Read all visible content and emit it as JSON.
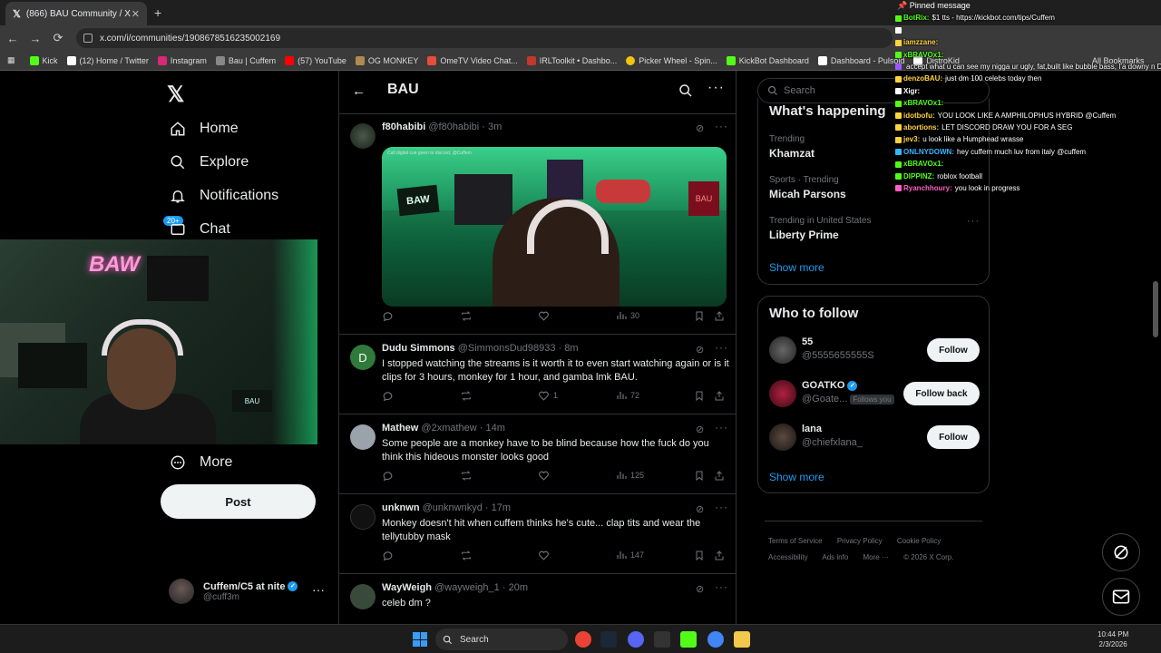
{
  "browser": {
    "tab_title": "(866) BAU Community / X",
    "url": "x.com/i/communities/1908678516235002169",
    "bookmarks": [
      "Kick",
      "(12) Home / Twitter",
      "Instagram",
      "Bau | Cuffem",
      "(57) YouTube",
      "OG MONKEY",
      "OmeTV Video Chat...",
      "IRLToolkit • Dashbo...",
      "Picker Wheel - Spin...",
      "KickBot Dashboard",
      "Dashboard - Pulsoid",
      "DistroKid"
    ],
    "all_bookmarks": "All Bookmarks"
  },
  "nav": {
    "items": [
      "Home",
      "Explore",
      "Notifications",
      "Chat",
      "More"
    ],
    "chat_badge": "20+",
    "post_label": "Post",
    "profile_name": "Cuffem/C5 at nite",
    "profile_handle": "@cuff3m"
  },
  "main": {
    "title": "BAU",
    "posts": [
      {
        "name": "f80habibi",
        "handle": "@f80habibi",
        "time": "· 3m",
        "text": "",
        "views": "30",
        "likes": "",
        "replies": "",
        "has_image": true,
        "image_caption": "Call digital cue given to discord, @Cuffem",
        "image_labels": {
          "left": "BAW",
          "right": "BAU"
        }
      },
      {
        "name": "Dudu Simmons",
        "handle": "@SimmonsDud98933",
        "time": "· 8m",
        "text": "I stopped watching the streams is it worth it to even start watching again or is it clips for 3 hours, monkey for 1 hour, and gamba lmk BAU.",
        "likes": "1",
        "views": "72",
        "avatar_letter": "D"
      },
      {
        "name": "Mathew",
        "handle": "@2xmathew",
        "time": "· 14m",
        "text": "Some people are a monkey have to be blind because how the fuck do you think this hideous monster looks good",
        "views": "125"
      },
      {
        "name": "unknwn",
        "handle": "@unknwnkyd",
        "time": "· 17m",
        "text": "Monkey doesn't hit when cuffem thinks he's cute... clap tits and wear the tellytubby mask",
        "views": "147"
      },
      {
        "name": "WayWeigh",
        "handle": "@wayweigh_1",
        "time": "· 20m",
        "text": "celeb dm ?",
        "views": ""
      }
    ]
  },
  "right": {
    "search_placeholder": "Search",
    "happening_title": "What's happening",
    "trends": [
      {
        "context": "Trending",
        "title": "Khamzat"
      },
      {
        "context": "Sports · Trending",
        "title": "Micah Parsons"
      },
      {
        "context": "Trending in United States",
        "title": "Liberty Prime"
      }
    ],
    "show_more": "Show more",
    "who_to_follow": "Who to follow",
    "follow_suggestions": [
      {
        "name": "55",
        "handle": "@5555655555S",
        "button": "Follow",
        "verified": false
      },
      {
        "name": "GOATKO",
        "handle": "@Goate...",
        "button": "Follow back",
        "verified": true,
        "follows_you": "Follows you"
      },
      {
        "name": "lana",
        "handle": "@chiefxlana_",
        "button": "Follow",
        "verified": false
      }
    ],
    "footer": [
      "Terms of Service",
      "Privacy Policy",
      "Cookie Policy",
      "Accessibility",
      "Ads info",
      "More ···",
      "© 2026 X Corp."
    ]
  },
  "chat": {
    "pinned": "Pinned message",
    "messages": [
      {
        "user": "BotRix",
        "text": "$1 tts - https://kickbot.com/tips/Cuffem",
        "color": "#53fc18"
      },
      {
        "user": "",
        "text": "",
        "color": "#ffffff"
      },
      {
        "user": "iamzzane",
        "text": "",
        "color": "#ffd23f"
      },
      {
        "user": "xBRAVOx1",
        "text": "",
        "color": "#53fc18"
      },
      {
        "user": "",
        "text": "accept what u can see my nigga ur ugly, fat,built like bubble bass, I'a downy n DL@cuffem",
        "color": "#9b59ff"
      },
      {
        "user": "denzoBAU",
        "text": "just dm 100 celebs today then",
        "color": "#ffd23f"
      },
      {
        "user": "Xigr",
        "text": "",
        "color": "#ffffff"
      },
      {
        "user": "xBRAVOx1",
        "text": "",
        "color": "#53fc18"
      },
      {
        "user": "idotbofu",
        "text": "YOU LOOK LIKE A AMPHILOPHUS HYBRID @Cuffem",
        "color": "#ffd23f"
      },
      {
        "user": "abortions",
        "text": "LET DISCORD DRAW YOU FOR A SEG",
        "color": "#ffd23f"
      },
      {
        "user": "jev3",
        "text": "u look like a Humphead wrasse",
        "color": "#ffd23f"
      },
      {
        "user": "ONLNYDOWN",
        "text": "hey cuffem much luv from italy @cuffem",
        "color": "#38b6ff"
      },
      {
        "user": "xBRAVOx1",
        "text": "",
        "color": "#53fc18"
      },
      {
        "user": "DIPPINZ",
        "text": "roblox football",
        "color": "#53fc18"
      },
      {
        "user": "Ryanchhoury",
        "text": "you look in progress",
        "color": "#ff5ec4"
      }
    ]
  },
  "taskbar": {
    "search": "Search",
    "time": "10:44 PM",
    "date": "2/3/2026"
  },
  "colors": {
    "accent": "#1d9bf0",
    "bg": "#000000",
    "border": "#2f3336",
    "muted": "#71767b"
  }
}
